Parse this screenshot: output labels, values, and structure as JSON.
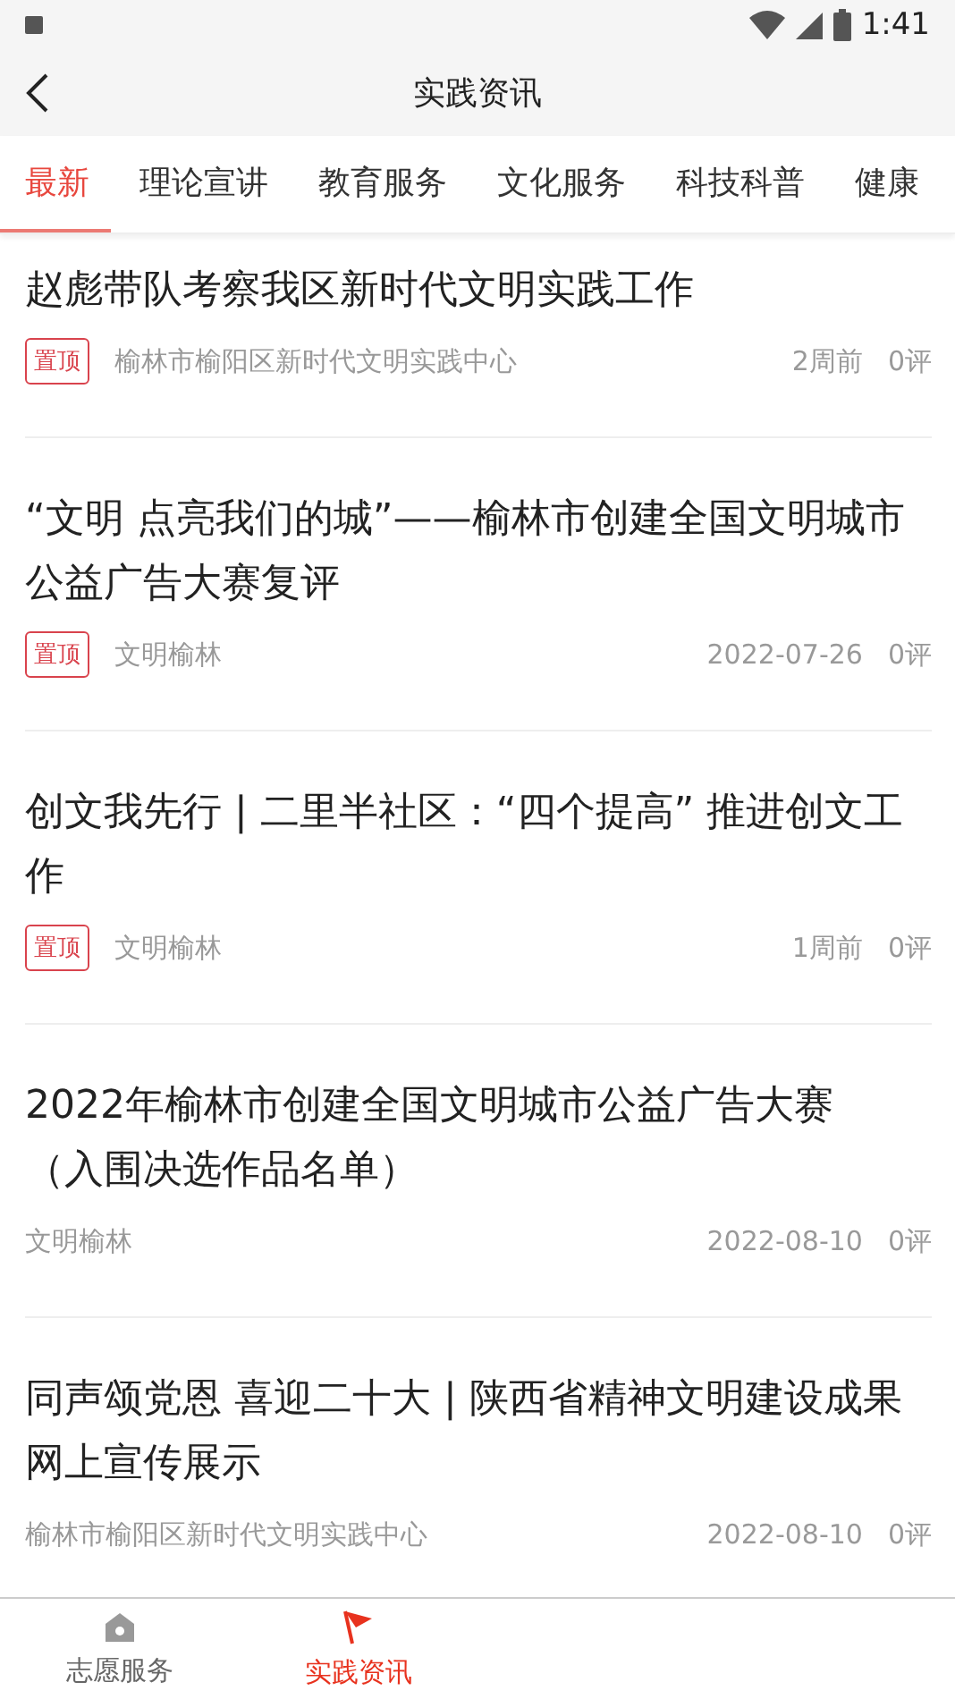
{
  "status_bar": {
    "time": "1:41"
  },
  "header": {
    "title": "实践资讯"
  },
  "tabs": [
    {
      "label": "最新",
      "selected": true
    },
    {
      "label": "理论宣讲",
      "selected": false
    },
    {
      "label": "教育服务",
      "selected": false
    },
    {
      "label": "文化服务",
      "selected": false
    },
    {
      "label": "科技科普",
      "selected": false
    },
    {
      "label": "健康",
      "selected": false
    }
  ],
  "articles": [
    {
      "title": "赵彪带队考察我区新时代文明实践工作",
      "pinned": true,
      "pin_label": "置顶",
      "source": "榆林市榆阳区新时代文明实践中心",
      "time": "2周前",
      "comments": "0评"
    },
    {
      "title": "“文明 点亮我们的城”——榆林市创建全国文明城市公益广告大赛复评",
      "pinned": true,
      "pin_label": "置顶",
      "source": "文明榆林",
      "time": "2022-07-26",
      "comments": "0评"
    },
    {
      "title": "创文我先行 | 二里半社区：“四个提高” 推进创文工作",
      "pinned": true,
      "pin_label": "置顶",
      "source": "文明榆林",
      "time": "1周前",
      "comments": "0评"
    },
    {
      "title": "2022年榆林市创建全国文明城市公益广告大赛（入围决选作品名单）",
      "pinned": false,
      "source": "文明榆林",
      "time": "2022-08-10",
      "comments": "0评"
    },
    {
      "title": "同声颂党恩 喜迎二十大 | 陕西省精神文明建设成果网上宣传展示",
      "pinned": false,
      "source": "榆林市榆阳区新时代文明实践中心",
      "time": "2022-08-10",
      "comments": "0评"
    }
  ],
  "bottom_nav": [
    {
      "label": "志愿服务",
      "selected": false
    },
    {
      "label": "实践资讯",
      "selected": true
    }
  ]
}
